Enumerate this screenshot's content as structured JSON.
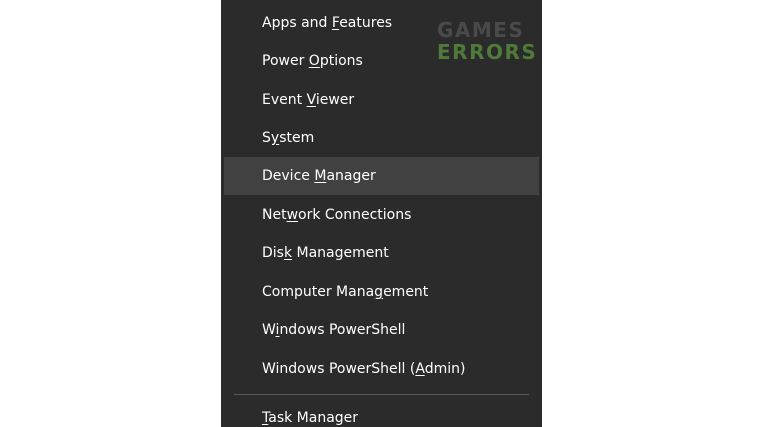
{
  "menu": {
    "items": [
      {
        "pre": "Apps and ",
        "key": "F",
        "post": "eatures",
        "highlighted": false
      },
      {
        "pre": "Power ",
        "key": "O",
        "post": "ptions",
        "highlighted": false
      },
      {
        "pre": "Event ",
        "key": "V",
        "post": "iewer",
        "highlighted": false
      },
      {
        "pre": "S",
        "key": "y",
        "post": "stem",
        "highlighted": false
      },
      {
        "pre": "Device ",
        "key": "M",
        "post": "anager",
        "highlighted": true
      },
      {
        "pre": "Net",
        "key": "w",
        "post": "ork Connections",
        "highlighted": false
      },
      {
        "pre": "Dis",
        "key": "k",
        "post": " Management",
        "highlighted": false
      },
      {
        "pre": "Computer Mana",
        "key": "g",
        "post": "ement",
        "highlighted": false
      },
      {
        "pre": "W",
        "key": "i",
        "post": "ndows PowerShell",
        "highlighted": false
      },
      {
        "pre": "Windows PowerShell (",
        "key": "A",
        "post": "dmin)",
        "highlighted": false
      },
      {
        "pre": "",
        "key": "T",
        "post": "ask Manager",
        "highlighted": false
      }
    ]
  },
  "watermark": {
    "line1": "GAMES",
    "line2": "ERRORS"
  },
  "colors": {
    "menu_background": "#2b2b2b",
    "highlight": "#414141",
    "text": "#ffffff",
    "watermark_green": "#4f7a3a"
  }
}
